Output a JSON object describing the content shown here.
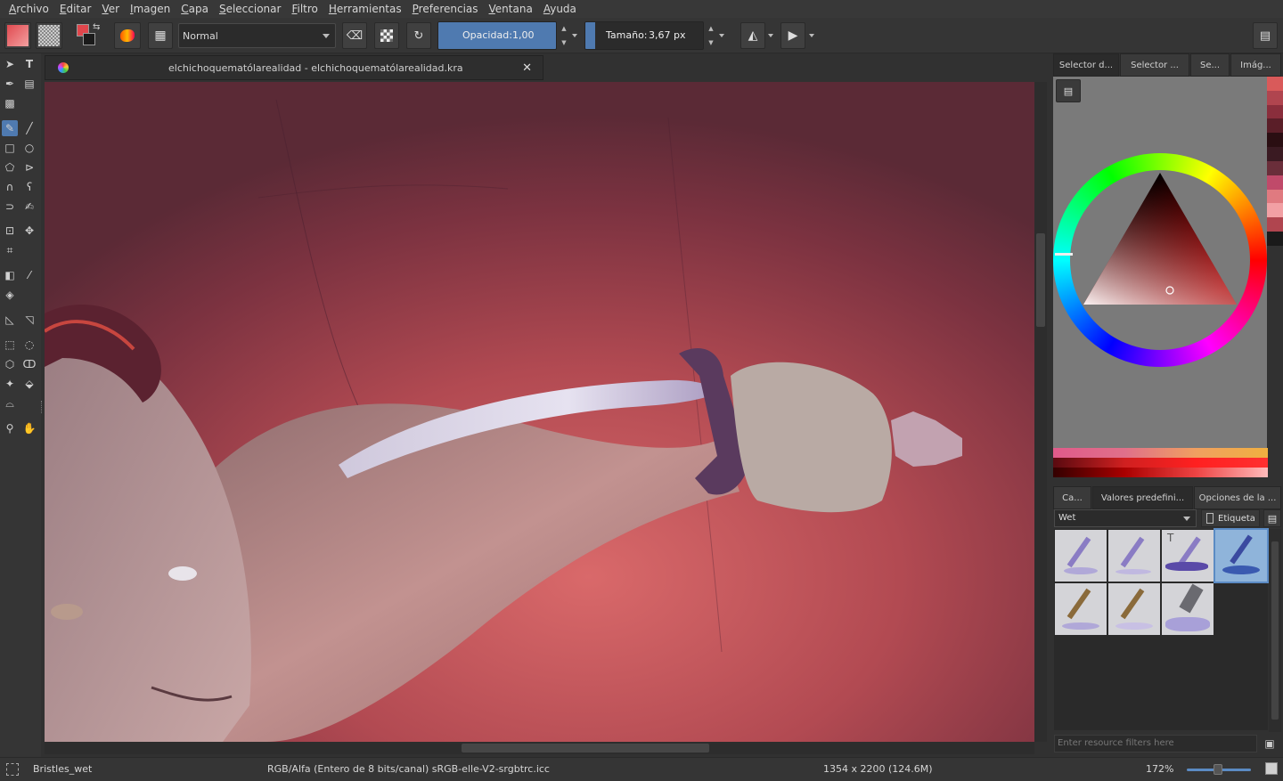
{
  "menu": [
    "Archivo",
    "Editar",
    "Ver",
    "Imagen",
    "Capa",
    "Seleccionar",
    "Filtro",
    "Herramientas",
    "Preferencias",
    "Ventana",
    "Ayuda"
  ],
  "menu_underline": [
    "A",
    "E",
    "V",
    "I",
    "C",
    "S",
    "F",
    "H",
    "P",
    "V",
    "A"
  ],
  "toolbar": {
    "blend_mode": "Normal",
    "opacity_label": "Opacidad:",
    "opacity_value": "1,00",
    "opacity_level": 1.0,
    "size_label": "Tamaño:",
    "size_value": "3,67 px",
    "size_level": 0.08
  },
  "document": {
    "tab_title": "elchichoquematólarealidad - elchichoquematólarealidad.kra",
    "close_glyph": "✕"
  },
  "dockers": {
    "top_tabs": [
      "Selector d...",
      "Selector ...",
      "Se...",
      "Imág..."
    ],
    "bottom_tabs": [
      "Ca...",
      "Valores predefini...",
      "Opciones de la ..."
    ],
    "preset_tag": "Wet",
    "tag_button": "Etiqueta",
    "filter_placeholder": "Enter resource filters here"
  },
  "colors": {
    "accent": "#4f7ab0",
    "fg_swatch": "#e0464c",
    "bg_swatch": "#1a1a1a"
  },
  "status": {
    "brush": "Bristles_wet",
    "color_space": "RGB/Alfa (Entero de 8 bits/canal)  sRGB-elle-V2-srgbtrc.icc",
    "dimensions": "1354 x 2200 (124.6M)",
    "zoom": "172%"
  }
}
